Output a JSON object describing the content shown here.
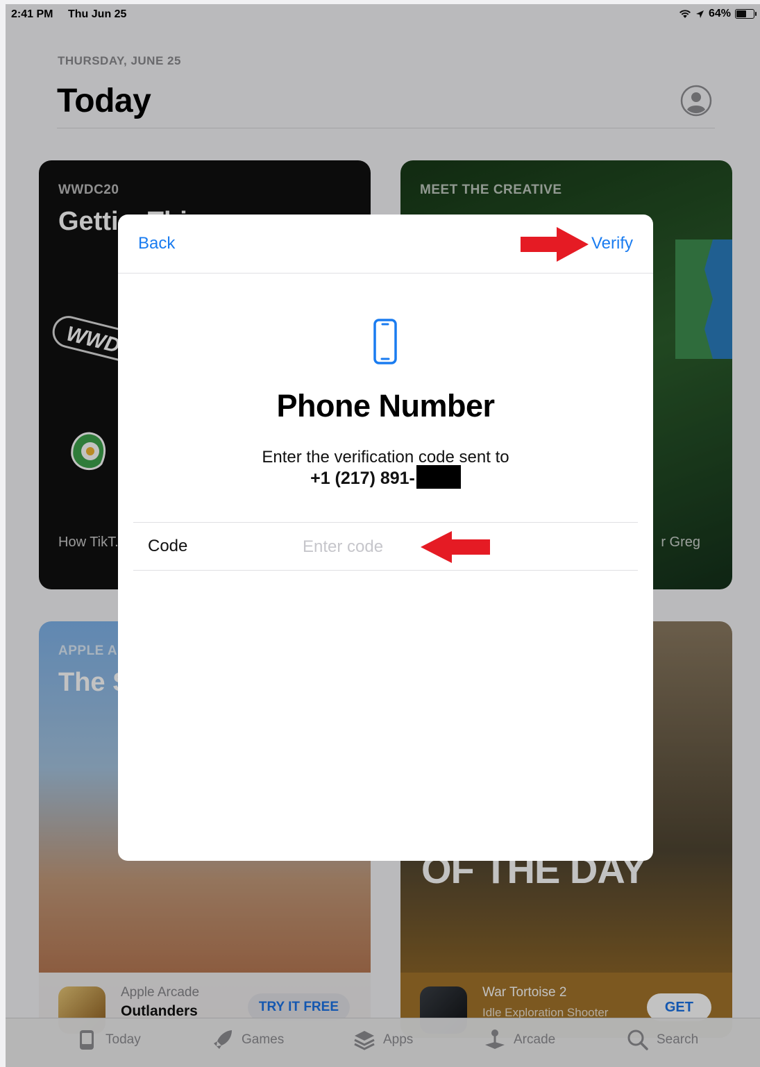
{
  "status_bar": {
    "time": "2:41 PM",
    "date": "Thu Jun 25",
    "battery": "64%",
    "battery_level": 0.64
  },
  "header": {
    "dateline": "THURSDAY, JUNE 25",
    "title": "Today"
  },
  "cards": [
    {
      "eyebrow": "WWDC20",
      "headline": "Getti... This",
      "subtitle": "How TikT... responde...",
      "badge": "WWDC"
    },
    {
      "eyebrow": "MEET THE CREATIVE",
      "subtitle": "r Greg"
    },
    {
      "eyebrow": "APPLE A...",
      "headline": "The S... Char...",
      "app_category": "Apple Arcade",
      "app_name": "Outlanders",
      "action": "TRY IT FREE"
    },
    {
      "headline": "OF THE DAY",
      "app_category": "War Tortoise 2",
      "app_name": "Idle Exploration Shooter",
      "action": "GET"
    }
  ],
  "modal": {
    "back_label": "Back",
    "verify_label": "Verify",
    "title": "Phone Number",
    "message": "Enter the verification code sent to",
    "phone_prefix": "+1 (217) 891-",
    "code_label": "Code",
    "code_placeholder": "Enter code",
    "code_value": ""
  },
  "tabs": [
    {
      "label": "Today",
      "icon": "today-icon"
    },
    {
      "label": "Games",
      "icon": "rocket-icon"
    },
    {
      "label": "Apps",
      "icon": "layers-icon"
    },
    {
      "label": "Arcade",
      "icon": "joystick-icon"
    },
    {
      "label": "Search",
      "icon": "search-icon"
    }
  ],
  "colors": {
    "accent": "#1a7cf0",
    "annotation_arrow": "#e51b24"
  }
}
